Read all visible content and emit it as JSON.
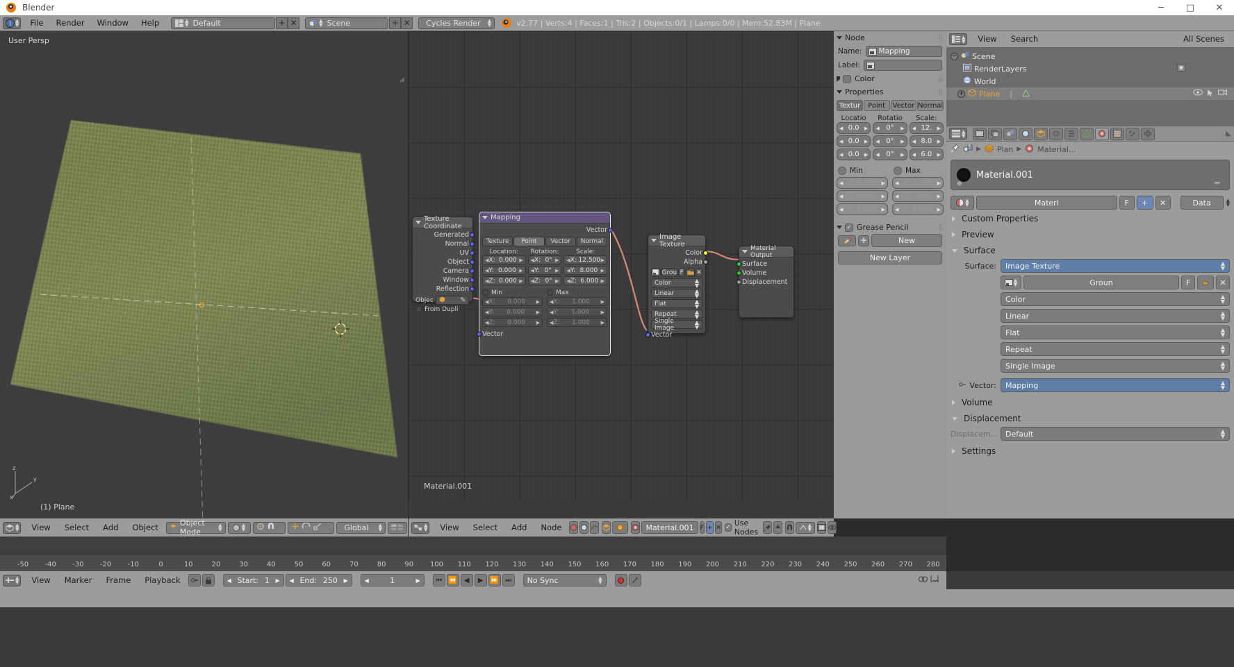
{
  "window": {
    "title": "Blender",
    "minimize": "─",
    "maximize": "□",
    "close": "✕"
  },
  "topbar": {
    "menus": [
      "File",
      "Render",
      "Window",
      "Help"
    ],
    "screen_layout": "Default",
    "scene_name": "Scene",
    "render_engine": "Cycles Render",
    "stats": "v2.77 | Verts:4 | Faces:1 | Tris:2 | Objects:0/1 | Lamps:0/0 | Mem:52.83M | Plane",
    "add_label": "+",
    "remove_label": "✕"
  },
  "viewport": {
    "view_label": "User Persp",
    "object_label": "(1) Plane",
    "axis_x": "x",
    "axis_y": "y",
    "axis_z": "z",
    "header": {
      "menus": [
        "View",
        "Select",
        "Add",
        "Object"
      ],
      "mode": "Object Mode",
      "transform_orientation": "Global"
    }
  },
  "node_editor": {
    "status_material": "Material.001",
    "header": {
      "menus": [
        "View",
        "Select",
        "Add",
        "Node"
      ],
      "material": "Material.001",
      "use_nodes": "Use Nodes",
      "f_label": "F",
      "add_label": "+",
      "remove_label": "✕"
    },
    "nodes": [
      {
        "name": "Texture Coordinate",
        "outputs": [
          "Generated",
          "Normal",
          "UV",
          "Object",
          "Camera",
          "Window",
          "Reflection"
        ],
        "object_label": "Objec",
        "from_dupli_label": "From Dupli"
      },
      {
        "name": "Mapping",
        "output": "Vector",
        "input": "Vector",
        "tabs": [
          "Texture",
          "Point",
          "Vector",
          "Normal"
        ],
        "active_tab": "Point",
        "columns": [
          "Location:",
          "Rotation:",
          "Scale:"
        ],
        "location": {
          "X": "0.000",
          "Y": "0.000",
          "Z": "0.000"
        },
        "rotation": {
          "X": "0°",
          "Y": "0°",
          "Z": "0°"
        },
        "scale": {
          "X": "12.500",
          "Y": "8.000",
          "Z": "6.000"
        },
        "min_label": "Min",
        "max_label": "Max",
        "min": {
          "X": "0.000",
          "Y": "0.000",
          "Z": "0.000"
        },
        "max": {
          "X": "1.000",
          "Y": "1.000",
          "Z": "1.000"
        }
      },
      {
        "name": "Image Texture",
        "outputs": [
          "Color",
          "Alpha"
        ],
        "input": "Vector",
        "image_name": "Grou",
        "f_label": "F",
        "close_label": "✕",
        "settings": [
          "Color",
          "Linear",
          "Flat",
          "Repeat",
          "Single Image"
        ]
      },
      {
        "name": "Material Output",
        "inputs": [
          "Surface",
          "Volume",
          "Displacement"
        ]
      }
    ]
  },
  "npanel": {
    "node_section": "Node",
    "name_label": "Name:",
    "name_value": "Mapping",
    "label_label": "Label:",
    "label_value": "",
    "color_section": "Color",
    "properties_section": "Properties",
    "tabs": [
      "Textur",
      "Point",
      "Vector",
      "Normal"
    ],
    "active_tab": "Point",
    "columns": [
      "Locatio",
      "Rotatio",
      "Scale:"
    ],
    "location": [
      "0.0",
      "0.0",
      "0.0"
    ],
    "rotation": [
      "0°",
      "0°",
      "0°"
    ],
    "scale": [
      "12.",
      "8.0",
      "6.0"
    ],
    "min_label": "Min",
    "max_label": "Max",
    "min": [
      "X: 0.000",
      "Y: 0.000",
      "Z: 0.000"
    ],
    "max": [
      "X: 1.000",
      "Y: 1.000",
      "Z: 1.000"
    ],
    "grease_pencil": "Grease Pencil",
    "new_button": "New",
    "new_layer_button": "New Layer"
  },
  "outliner": {
    "menus": [
      "View",
      "Search"
    ],
    "display_mode": "All Scenes",
    "rows": [
      {
        "label": "Scene",
        "indent": 0,
        "icon": "scene-icon",
        "active": false
      },
      {
        "label": "RenderLayers",
        "indent": 1,
        "icon": "renderlayers-icon",
        "active": false
      },
      {
        "label": "World",
        "indent": 1,
        "icon": "world-icon",
        "active": false
      },
      {
        "label": "Plane",
        "indent": 1,
        "icon": "mesh-icon",
        "active": true
      }
    ]
  },
  "properties": {
    "breadcrumb": [
      "Plan",
      "Material..."
    ],
    "material_name": "Material.001",
    "datablock_label": "Materi",
    "f_label": "F",
    "add_label": "+",
    "remove_label": "✕",
    "data_label": "Data",
    "sections": {
      "custom_properties": "Custom Properties",
      "preview": "Preview",
      "surface": "Surface",
      "volume": "Volume",
      "displacement": "Displacement",
      "settings": "Settings"
    },
    "surface_label": "Surface:",
    "surface_value": "Image Texture",
    "image_name": "Groun",
    "image_f": "F",
    "image_close": "✕",
    "image_options": [
      "Color",
      "Linear",
      "Flat",
      "Repeat",
      "Single Image"
    ],
    "vector_label": "Vector:",
    "vector_value": "Mapping",
    "displacement_label": "Displacem...",
    "displacement_value": "Default"
  },
  "timeline": {
    "menus": [
      "View",
      "Marker",
      "Frame",
      "Playback"
    ],
    "start_label": "Start:",
    "start_value": "1",
    "end_label": "End:",
    "end_value": "250",
    "current_frame": "1",
    "sync_mode": "No Sync",
    "ticks": [
      "-50",
      "-40",
      "-30",
      "-20",
      "-10",
      "0",
      "10",
      "20",
      "30",
      "40",
      "50",
      "60",
      "70",
      "80",
      "90",
      "100",
      "110",
      "120",
      "130",
      "140",
      "150",
      "160",
      "170",
      "180",
      "190",
      "200",
      "210",
      "220",
      "230",
      "240",
      "250",
      "260",
      "270",
      "280"
    ]
  },
  "colors": {
    "accent_orange": "#e87d0d",
    "header_gray": "#9c9c9c",
    "panel_dark": "#3c3c3c",
    "socket_vector": "#6363ff",
    "socket_color": "#ffff2b",
    "socket_shader": "#39c846",
    "noodle": "#d88a7a",
    "plane_green": "#879056"
  }
}
